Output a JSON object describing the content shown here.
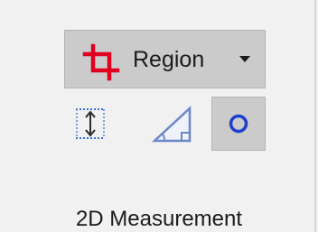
{
  "ribbon": {
    "group_label": "2D Measurement",
    "region_button": {
      "label": "Region",
      "icon": "crop-icon",
      "has_dropdown": true
    },
    "tools": [
      {
        "name": "distance",
        "icon": "vertical-distance-icon",
        "selected": false
      },
      {
        "name": "angle",
        "icon": "angle-triangle-icon",
        "selected": false
      },
      {
        "name": "circle",
        "icon": "circle-icon",
        "selected": true
      }
    ]
  },
  "colors": {
    "background": "#f1f1f1",
    "button_active": "#cbcbcb",
    "crop_icon_red": "#e00020",
    "tool_blue": "#1f5ed8",
    "circle_blue": "#1e3fd0",
    "text": "#1b1b1b"
  }
}
